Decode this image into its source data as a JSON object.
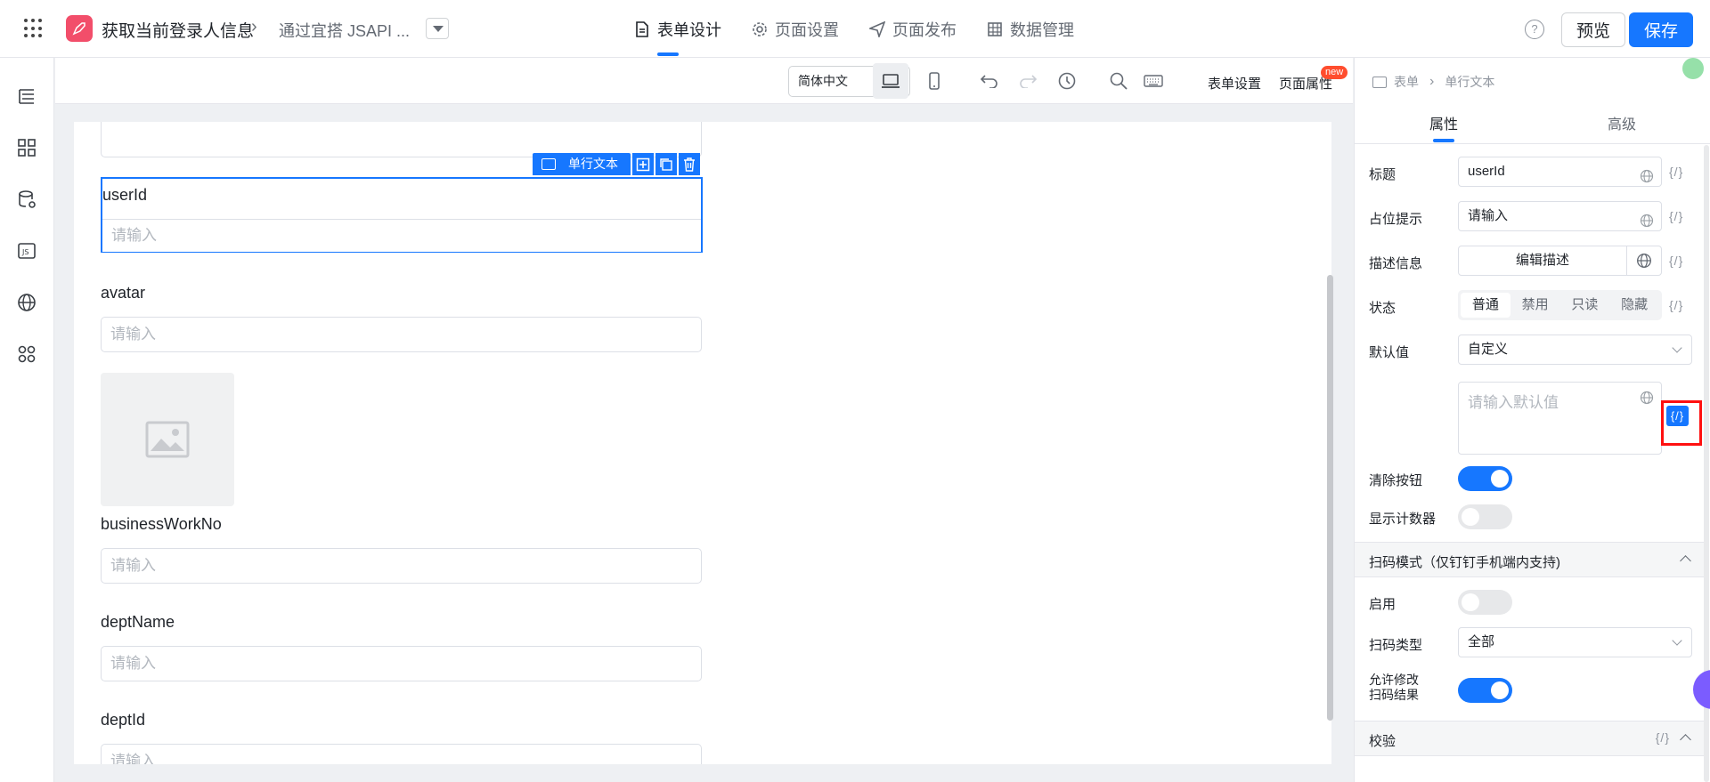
{
  "header": {
    "app_title": "获取当前登录人信息",
    "page_title": "通过宜搭 JSAPI ...",
    "tabs": [
      {
        "label": "表单设计",
        "icon": "document-icon",
        "active": true
      },
      {
        "label": "页面设置",
        "icon": "gear-icon",
        "active": false
      },
      {
        "label": "页面发布",
        "icon": "send-icon",
        "active": false
      },
      {
        "label": "数据管理",
        "icon": "table-icon",
        "active": false
      }
    ],
    "preview_label": "预览",
    "save_label": "保存"
  },
  "toolbar": {
    "language": "简体中文",
    "form_settings": "表单设置",
    "page_properties": "页面属性",
    "new_badge": "new"
  },
  "canvas": {
    "selected_component_tag": "单行文本",
    "fields": [
      {
        "label": "userId",
        "placeholder": "请输入"
      },
      {
        "label": "avatar",
        "placeholder": "请输入"
      },
      {
        "label": "businessWorkNo",
        "placeholder": "请输入"
      },
      {
        "label": "deptName",
        "placeholder": "请输入"
      },
      {
        "label": "deptId",
        "placeholder": "请输入"
      }
    ]
  },
  "panel": {
    "breadcrumb": [
      "表单",
      "单行文本"
    ],
    "tabs": [
      "属性",
      "高级"
    ],
    "expr_symbol": "{/}",
    "props": {
      "title_label": "标题",
      "title_value": "userId",
      "placeholder_label": "占位提示",
      "placeholder_value": "请输入",
      "description_label": "描述信息",
      "description_button": "编辑描述",
      "status_label": "状态",
      "status_options": [
        "普通",
        "禁用",
        "只读",
        "隐藏"
      ],
      "status_selected": "普通",
      "default_label": "默认值",
      "default_mode": "自定义",
      "default_placeholder": "请输入默认值",
      "clear_button_label": "清除按钮",
      "clear_button_on": true,
      "show_counter_label": "显示计数器",
      "show_counter_on": false
    },
    "scan_section": {
      "title": "扫码模式（仅钉钉手机端内支持)",
      "enable_label": "启用",
      "enable_on": false,
      "scan_type_label": "扫码类型",
      "scan_type_value": "全部",
      "allow_modify_label_1": "允许修改",
      "allow_modify_label_2": "扫码结果",
      "allow_modify_on": true
    },
    "validation_section": {
      "title": "校验"
    }
  }
}
